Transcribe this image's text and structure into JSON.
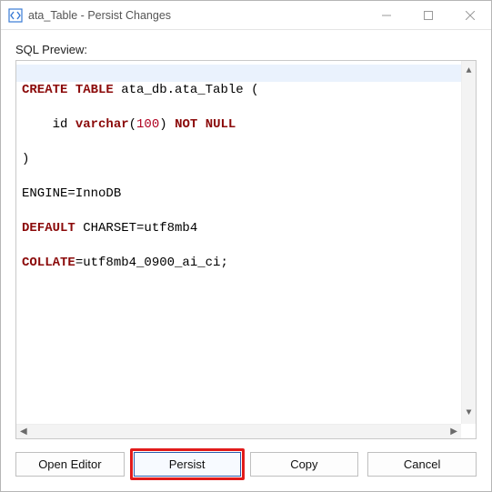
{
  "window": {
    "title": "ata_Table - Persist Changes"
  },
  "preview": {
    "label": "SQL Preview:"
  },
  "sql": {
    "line1_a": "CREATE",
    "line1_b": " ",
    "line1_c": "TABLE",
    "line1_d": " ata_db.ata_Table (",
    "line2_a": "    id ",
    "line2_b": "varchar",
    "line2_c": "(",
    "line2_d": "100",
    "line2_e": ") ",
    "line2_f": "NOT",
    "line2_g": " ",
    "line2_h": "NULL",
    "line3": ")",
    "line4": "ENGINE=InnoDB",
    "line5_a": "DEFAULT",
    "line5_b": " CHARSET=utf8mb4",
    "line6_a": "COLLATE",
    "line6_b": "=utf8mb4_0900_ai_ci;"
  },
  "buttons": {
    "open_editor": "Open Editor",
    "persist": "Persist",
    "copy": "Copy",
    "cancel": "Cancel"
  }
}
